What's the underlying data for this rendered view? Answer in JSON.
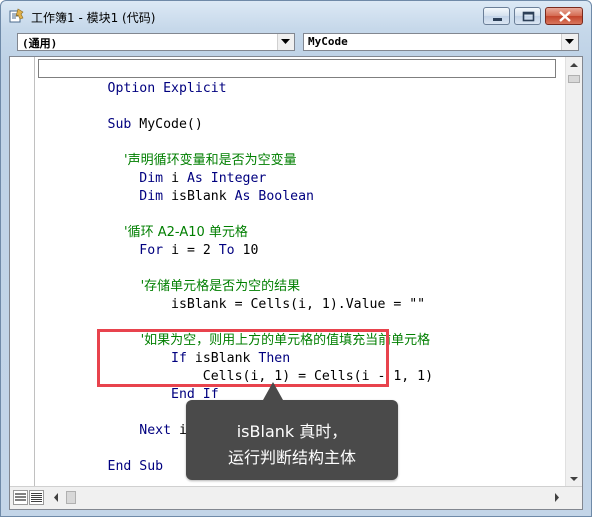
{
  "window": {
    "title": "工作簿1 - 模块1 (代码)",
    "icons": {
      "app": "vba-module-icon",
      "minimize": "minimize-icon",
      "maximize": "maximize-icon",
      "close": "close-icon"
    }
  },
  "selectors": {
    "object_value": "(通用)",
    "procedure_value": "MyCode"
  },
  "code_lines": [
    {
      "segments": [
        {
          "t": "kw",
          "v": "Option Explicit"
        }
      ]
    },
    {
      "segments": [
        {
          "t": "kw",
          "v": "Sub "
        },
        {
          "t": "tx",
          "v": "MyCode()"
        }
      ]
    },
    {
      "segments": [
        {
          "t": "cm",
          "v": "    '声明循环变量和是否为空变量"
        }
      ]
    },
    {
      "segments": [
        {
          "t": "kw",
          "v": "    Dim "
        },
        {
          "t": "tx",
          "v": "i "
        },
        {
          "t": "kw",
          "v": "As Integer"
        }
      ]
    },
    {
      "segments": [
        {
          "t": "kw",
          "v": "    Dim "
        },
        {
          "t": "tx",
          "v": "isBlank "
        },
        {
          "t": "kw",
          "v": "As Boolean"
        }
      ]
    },
    {
      "segments": [
        {
          "t": "cm",
          "v": "    '循环 A2-A10 单元格"
        }
      ]
    },
    {
      "segments": [
        {
          "t": "kw",
          "v": "    For "
        },
        {
          "t": "tx",
          "v": "i = 2 "
        },
        {
          "t": "kw",
          "v": "To "
        },
        {
          "t": "tx",
          "v": "10"
        }
      ]
    },
    {
      "segments": [
        {
          "t": "cm",
          "v": "        '存储单元格是否为空的结果"
        }
      ]
    },
    {
      "segments": [
        {
          "t": "tx",
          "v": "        isBlank = Cells(i, 1).Value = \"\""
        }
      ]
    },
    {
      "segments": [
        {
          "t": "cm",
          "v": "        '如果为空，则用上方的单元格的值填充当前单元格"
        }
      ]
    },
    {
      "segments": [
        {
          "t": "kw",
          "v": "        If "
        },
        {
          "t": "tx",
          "v": "isBlank "
        },
        {
          "t": "kw",
          "v": "Then"
        }
      ]
    },
    {
      "segments": [
        {
          "t": "tx",
          "v": "            Cells(i, 1) = Cells(i - 1, 1)"
        }
      ]
    },
    {
      "segments": [
        {
          "t": "kw",
          "v": "        End If"
        }
      ]
    },
    {
      "segments": [
        {
          "t": "kw",
          "v": "    Next "
        },
        {
          "t": "tx",
          "v": "i"
        }
      ]
    },
    {
      "segments": [
        {
          "t": "kw",
          "v": "End Sub"
        }
      ]
    }
  ],
  "callout": {
    "line1": "isBlank 真时，",
    "line2": "运行判断结构主体"
  },
  "colors": {
    "keyword": "#00007f",
    "comment": "#007f00",
    "text": "#000000",
    "highlight_border": "#e8434d",
    "callout_bg": "#4a4a4a"
  }
}
